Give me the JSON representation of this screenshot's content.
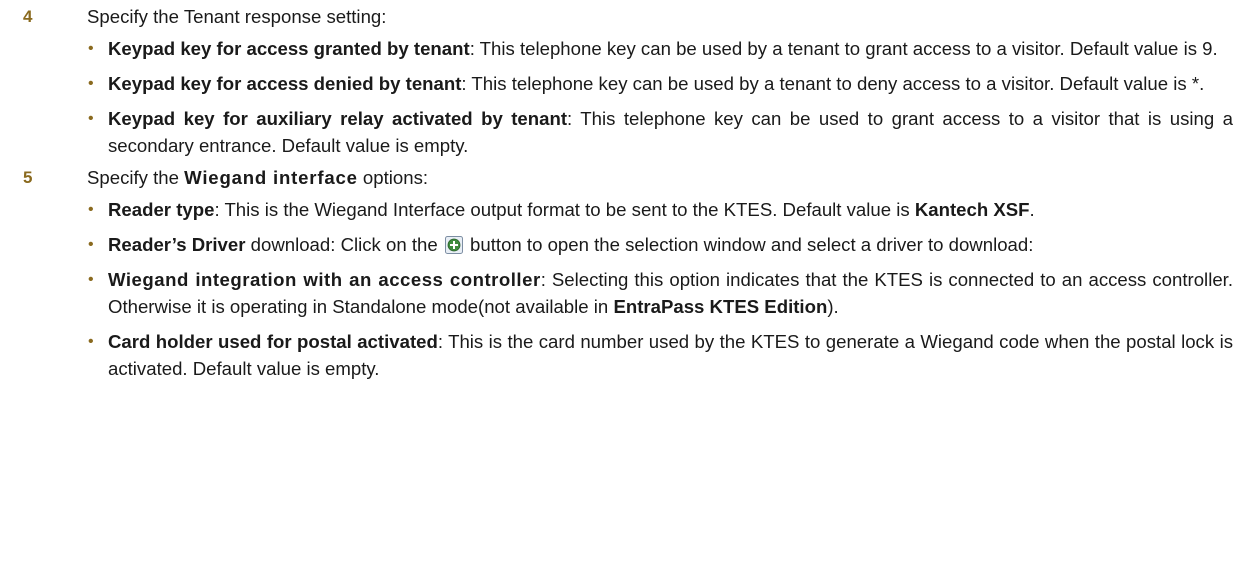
{
  "steps": [
    {
      "number": "4",
      "intro": "Specify the Tenant response setting:",
      "bullets": [
        {
          "term": "Keypad key for access granted by tenant",
          "text": ": This telephone key can be used by a tenant to grant access to a visitor. Default value is 9."
        },
        {
          "term": "Keypad key for access denied by tenant",
          "text": ": This telephone key can be used by a tenant to deny access to a visitor. Default value is *."
        },
        {
          "term": "Keypad key for auxiliary relay activated by tenant",
          "text": ": This telephone key can be used to grant access to a visitor that is using a secondary entrance. Default value is empty."
        }
      ]
    },
    {
      "number": "5",
      "intro_pre": "Specify the ",
      "intro_term": "Wiegand interface",
      "intro_post": " options:",
      "bullets": [
        {
          "term": "Reader type",
          "text": ": This is the Wiegand Interface output format to be sent to the KTES. Default value is ",
          "term2": "Kantech XSF",
          "text2": "."
        },
        {
          "term": "Reader’s Driver",
          "text": " download: Click on the ",
          "icon": "add-icon",
          "text2": " button to open the selection window and select a driver to download:"
        },
        {
          "term": "Wiegand integration with an access controller",
          "text": ": Selecting this option indicates that the KTES is connected to an access controller. Otherwise it is operating in Standalone mode(not available in ",
          "term2": "EntraPass KTES Edition",
          "text2": ")."
        },
        {
          "term": "Card holder used for postal activated",
          "text": ": This is the card number used by the KTES to generate a Wiegand code when the postal lock is activated. Default value is empty."
        }
      ]
    }
  ],
  "bullet_glyph": "•",
  "colors": {
    "step_number": "#8a6a1f",
    "bullet": "#8a6a1f",
    "icon_green": "#3d8b3d",
    "icon_border": "#2e6e9e"
  }
}
